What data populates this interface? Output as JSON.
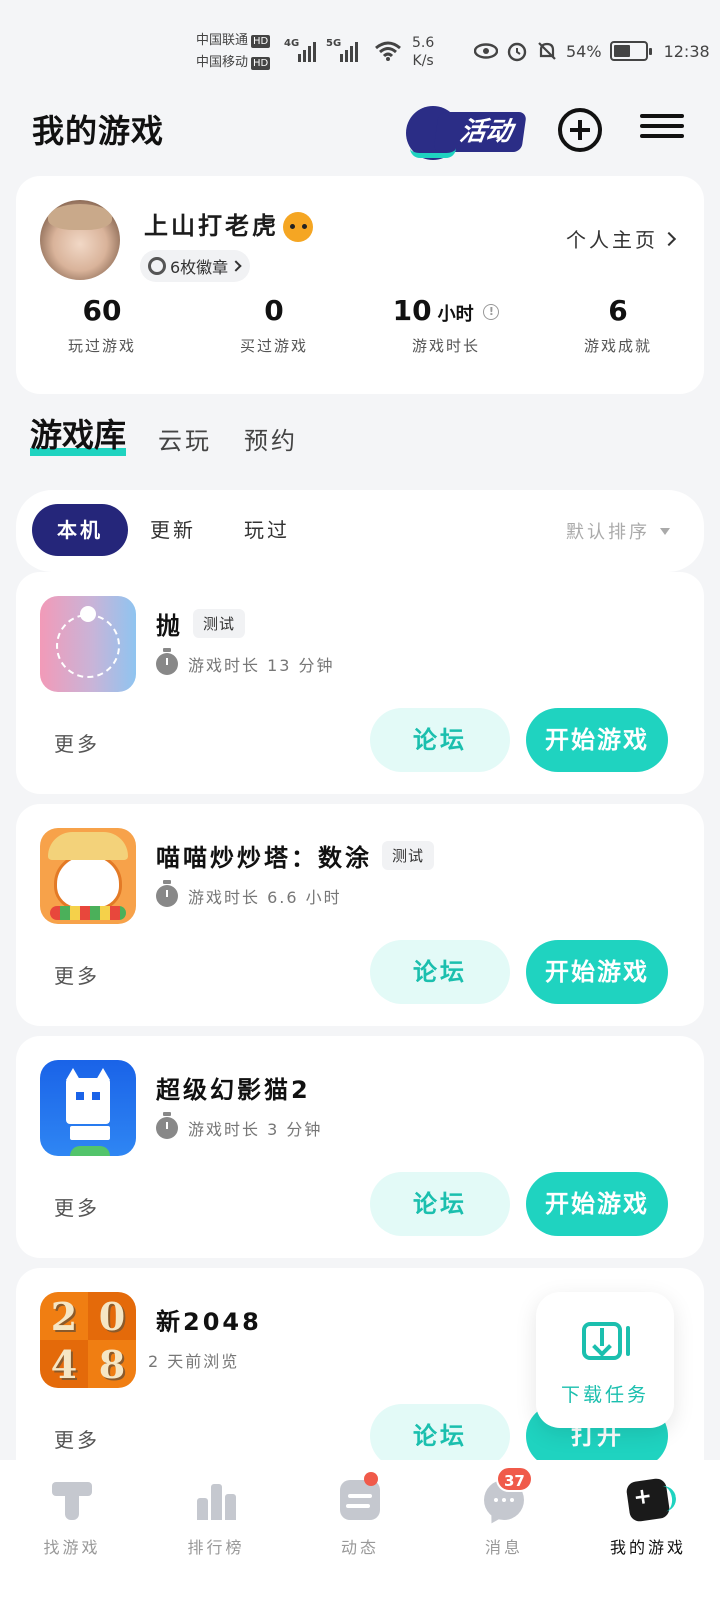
{
  "status_bar": {
    "carrier1": "中国联通",
    "carrier2": "中国移动",
    "hd": "HD",
    "net1": "4G",
    "net2": "5G",
    "speed_value": "5.6",
    "speed_unit": "K/s",
    "battery": "54%",
    "battery_level": 0.54,
    "time": "12:38"
  },
  "header": {
    "title": "我的游戏",
    "activity_label": "活动"
  },
  "profile": {
    "username": "上山打老虎",
    "medals": "6枚徽章",
    "homepage_link": "个人主页",
    "stats": [
      {
        "value": "60",
        "unit": "",
        "label": "玩过游戏"
      },
      {
        "value": "0",
        "unit": "",
        "label": "买过游戏"
      },
      {
        "value": "10",
        "unit": "小时",
        "label": "游戏时长"
      },
      {
        "value": "6",
        "unit": "",
        "label": "游戏成就"
      }
    ]
  },
  "library_tabs": [
    "游戏库",
    "云玩",
    "预约"
  ],
  "filter": {
    "chips": [
      "本机",
      "更新",
      "玩过"
    ],
    "sort": "默认排序"
  },
  "games": [
    {
      "name": "抛",
      "tag": "测试",
      "meta": "游戏时长 13 分钟",
      "more": "更多",
      "forum": "论坛",
      "action": "开始游戏"
    },
    {
      "name": "喵喵炒炒塔：数涂",
      "tag": "测试",
      "meta": "游戏时长 6.6 小时",
      "more": "更多",
      "forum": "论坛",
      "action": "开始游戏"
    },
    {
      "name": "超级幻影猫2",
      "tag": "",
      "meta": "游戏时长 3 分钟",
      "more": "更多",
      "forum": "论坛",
      "action": "开始游戏"
    },
    {
      "name": "新2048",
      "tag": "",
      "meta": "2 天前浏览",
      "more": "更多",
      "forum": "论坛",
      "action": "打开"
    }
  ],
  "icon_2048_tiles": [
    "2",
    "0",
    "4",
    "8"
  ],
  "download_task": "下载任务",
  "bottom_nav": {
    "items": [
      "找游戏",
      "排行榜",
      "动态",
      "消息",
      "我的游戏"
    ],
    "message_badge": "37"
  }
}
